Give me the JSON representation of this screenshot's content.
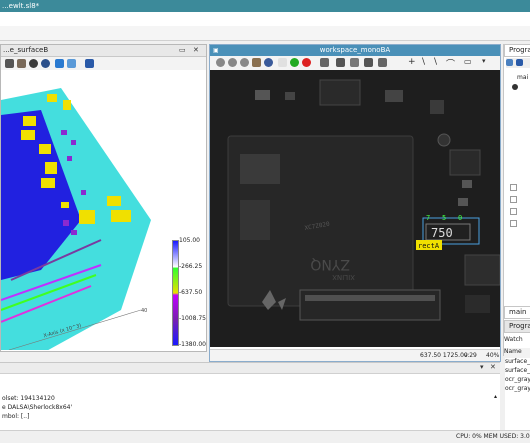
{
  "window": {
    "title": "...ewlt.sl8*"
  },
  "left_panel": {
    "title": "...e_surfaceB"
  },
  "right_panel": {
    "title": "workspace_monoBA"
  },
  "colorbar": {
    "ticks": [
      "105.00",
      "-266.25",
      "-637.50",
      "-1008.75",
      "-1380.00"
    ]
  },
  "axis": {
    "label": "X-Axis (x 10^3)",
    "tick": "40"
  },
  "overlay": {
    "rect_label": "rectA",
    "ocr_text": "750",
    "ocr_digits": [
      "7",
      "5",
      "0"
    ]
  },
  "image_status": {
    "coords": "637.50 1725.00",
    "value": "v:29",
    "zoom": "40%"
  },
  "program_panel": {
    "tab_label": "Program",
    "tree_root": "mai",
    "tabs": [
      "main",
      "Program"
    ],
    "watch_title": "Watch",
    "watch_header": "Name",
    "watch_items": [
      "surface_",
      "surface_",
      "ocr_gray",
      "ocr_gray"
    ]
  },
  "output_log": {
    "lines": [
      "olset: 194134120",
      "e DALSA\\Sherlock8x64'",
      "mbol: [..]"
    ]
  },
  "statusbar": {
    "text": "CPU: 0% MEM USED: 3.0"
  },
  "colors": {
    "titlebar": "#3c8a9a",
    "panel_active": "#4a90b8",
    "accent_cyan": "#38e0e0",
    "accent_yellow": "#e8e000"
  }
}
